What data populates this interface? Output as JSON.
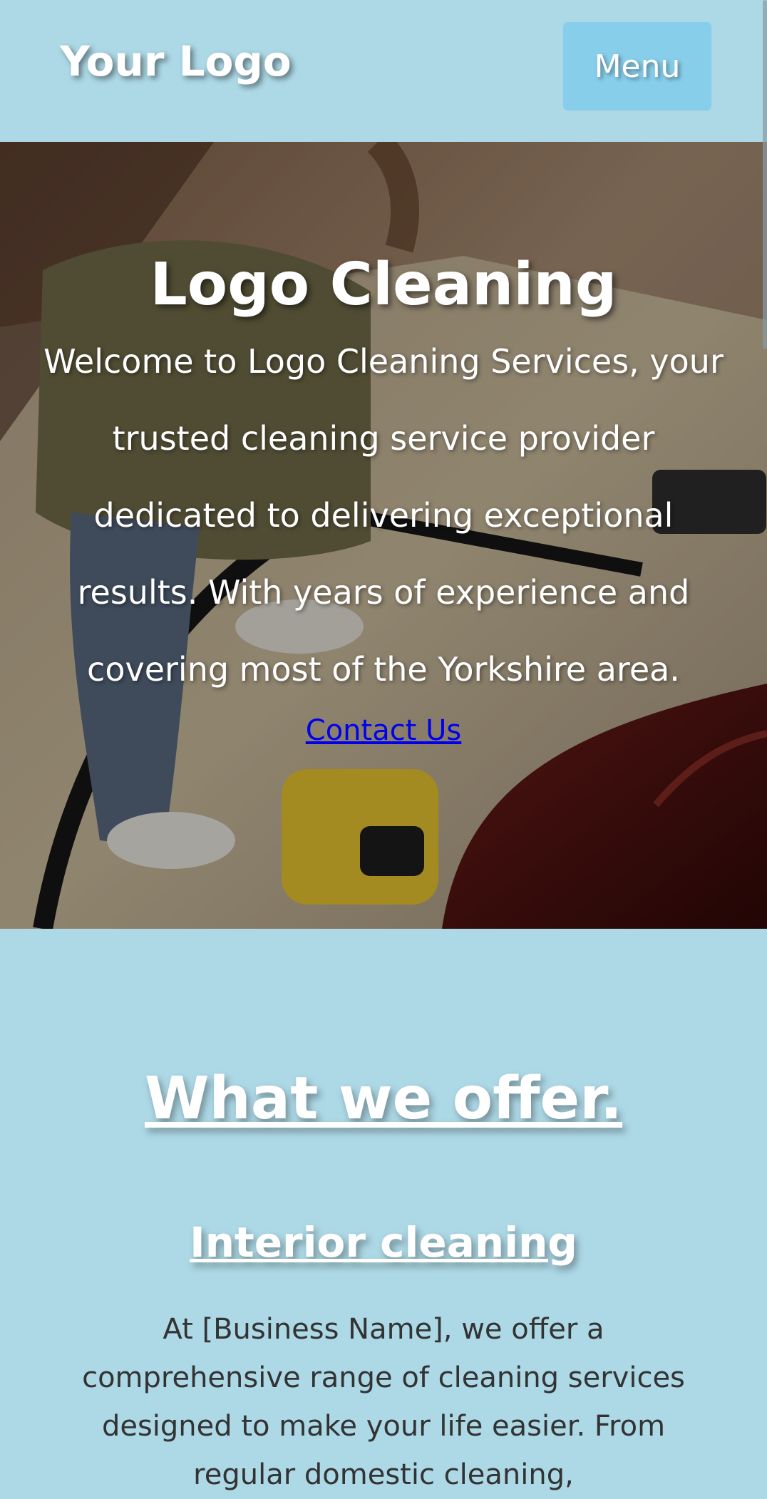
{
  "header": {
    "logo_text": "Your Logo",
    "menu_label": "Menu"
  },
  "hero": {
    "title": "Logo Cleaning",
    "text": "Welcome to Logo Cleaning Services, your trusted cleaning service provider dedicated to delivering exceptional results. With years of experience and covering most of the Yorkshire area.",
    "cta_label": "Contact Us"
  },
  "offer": {
    "title": "What we offer.",
    "service_title": "Interior cleaning",
    "service_text": "At [Business Name], we offer a comprehensive range of cleaning services designed to make your life easier. From regular domestic cleaning,"
  },
  "colors": {
    "background": "#add8e6",
    "menu_button": "#87ceeb",
    "link": "#0000ee"
  }
}
